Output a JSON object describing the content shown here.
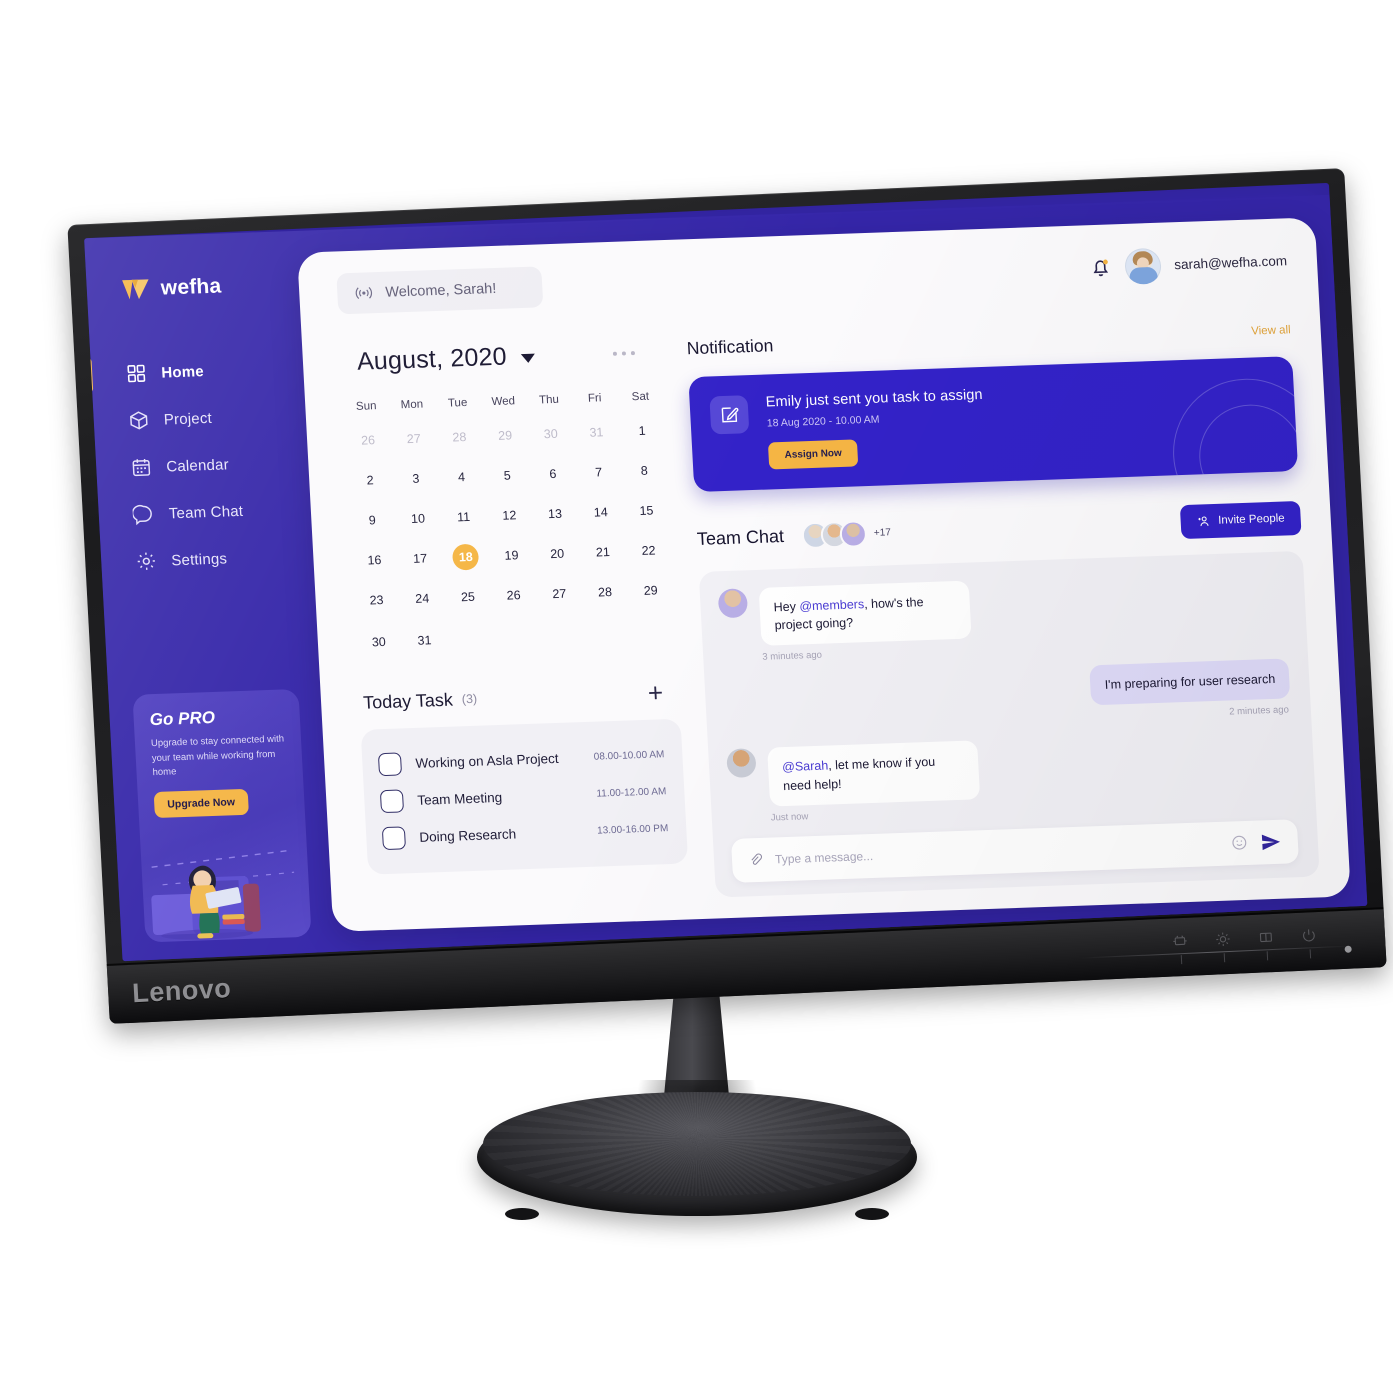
{
  "monitor": {
    "brand": "Lenovo",
    "osd_buttons": [
      "input-source-icon",
      "brightness-icon",
      "layout-icon",
      "power-icon"
    ],
    "osd_sub_labels": [
      "menu-icon",
      "up-arrow",
      "down-arrow",
      "enter-arrow"
    ]
  },
  "app": {
    "brand": {
      "name": "wefha",
      "logo": "wefha-logo-icon"
    },
    "accent_purple": "#3526A9",
    "accent_card_purple": "#3322C8",
    "accent_yellow": "#F5B544",
    "sidebar": {
      "items": [
        {
          "label": "Home",
          "icon": "grid-icon",
          "active": true
        },
        {
          "label": "Project",
          "icon": "cube-icon",
          "active": false
        },
        {
          "label": "Calendar",
          "icon": "calendar-icon",
          "active": false
        },
        {
          "label": "Team Chat",
          "icon": "chat-bubble-icon",
          "active": false
        },
        {
          "label": "Settings",
          "icon": "gear-icon",
          "active": false
        }
      ],
      "promo": {
        "title": "Go PRO",
        "description": "Upgrade to stay connected with your team while working from home",
        "button": "Upgrade Now"
      }
    },
    "topbar": {
      "welcome": "Welcome, Sarah!",
      "welcome_icon": "broadcast-icon",
      "bell_icon": "bell-icon",
      "email": "sarah@wefha.com",
      "avatar": "user-avatar"
    },
    "calendar": {
      "title": "August, 2020",
      "dropdown_icon": "caret-down-icon",
      "more_icon": "more-dots-icon",
      "weekdays": [
        "Sun",
        "Mon",
        "Tue",
        "Wed",
        "Thu",
        "Fri",
        "Sat"
      ],
      "weeks": [
        [
          {
            "d": "26",
            "mut": true
          },
          {
            "d": "27",
            "mut": true
          },
          {
            "d": "28",
            "mut": true
          },
          {
            "d": "29",
            "mut": true
          },
          {
            "d": "30",
            "mut": true
          },
          {
            "d": "31",
            "mut": true
          },
          {
            "d": "1"
          }
        ],
        [
          {
            "d": "2"
          },
          {
            "d": "3"
          },
          {
            "d": "4"
          },
          {
            "d": "5"
          },
          {
            "d": "6"
          },
          {
            "d": "7"
          },
          {
            "d": "8"
          }
        ],
        [
          {
            "d": "9"
          },
          {
            "d": "10"
          },
          {
            "d": "11"
          },
          {
            "d": "12"
          },
          {
            "d": "13"
          },
          {
            "d": "14"
          },
          {
            "d": "15"
          }
        ],
        [
          {
            "d": "16"
          },
          {
            "d": "17"
          },
          {
            "d": "18",
            "today": true
          },
          {
            "d": "19"
          },
          {
            "d": "20"
          },
          {
            "d": "21"
          },
          {
            "d": "22"
          }
        ],
        [
          {
            "d": "23"
          },
          {
            "d": "24"
          },
          {
            "d": "25"
          },
          {
            "d": "26"
          },
          {
            "d": "27"
          },
          {
            "d": "28"
          },
          {
            "d": "29"
          }
        ],
        [
          {
            "d": "30"
          },
          {
            "d": "31"
          },
          {
            "d": ""
          },
          {
            "d": ""
          },
          {
            "d": ""
          },
          {
            "d": ""
          },
          {
            "d": ""
          }
        ]
      ],
      "selected_day": "18"
    },
    "today_task": {
      "title": "Today Task",
      "count": "(3)",
      "add_icon": "plus-icon",
      "items": [
        {
          "name": "Working on Asla Project",
          "time": "08.00-10.00 AM",
          "checked": false
        },
        {
          "name": "Team Meeting",
          "time": "11.00-12.00 AM",
          "checked": false
        },
        {
          "name": "Doing Research",
          "time": "13.00-16.00 PM",
          "checked": false
        }
      ]
    },
    "notification": {
      "title": "Notification",
      "view_all": "View all",
      "icon": "edit-square-icon",
      "headline": "Emily just sent you task to assign",
      "timestamp": "18 Aug 2020 - 10.00 AM",
      "button": "Assign Now"
    },
    "team_chat": {
      "title": "Team Chat",
      "extra_members": "+17",
      "invite_button": "Invite People",
      "invite_icon": "add-person-icon",
      "messages": [
        {
          "side": "in",
          "mention": "@members",
          "pre": "Hey ",
          "post": ", how's the project going?",
          "stamp": "3 minutes ago"
        },
        {
          "side": "out",
          "pre": "I'm preparing for user research",
          "mention": "",
          "post": "",
          "stamp": "2 minutes ago"
        },
        {
          "side": "in",
          "mention": "@Sarah",
          "pre": "",
          "post": ", let me know if you need help!",
          "stamp": "Just now"
        }
      ],
      "composer": {
        "placeholder": "Type a message...",
        "value": "",
        "attach_icon": "paperclip-icon",
        "emoji_icon": "smiley-icon",
        "send_icon": "send-icon"
      }
    }
  }
}
